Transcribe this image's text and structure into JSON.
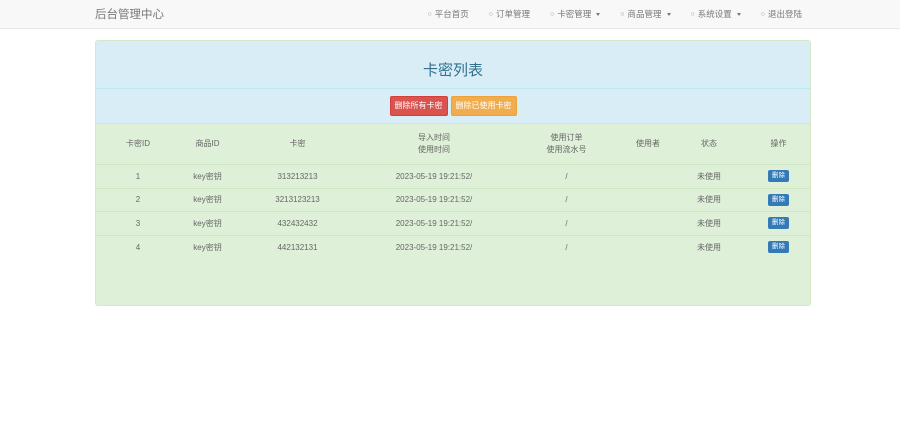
{
  "brand": "后台管理中心",
  "nav": [
    {
      "label": "平台首页",
      "dropdown": false
    },
    {
      "label": "订单管理",
      "dropdown": false
    },
    {
      "label": "卡密管理",
      "dropdown": true
    },
    {
      "label": "商品管理",
      "dropdown": true
    },
    {
      "label": "系统设置",
      "dropdown": true
    },
    {
      "label": "退出登陆",
      "dropdown": false
    }
  ],
  "panel": {
    "title": "卡密列表",
    "delete_all_label": "删除所有卡密",
    "delete_used_label": "删除已使用卡密"
  },
  "table": {
    "headers": {
      "id": "卡密ID",
      "product": "商品ID",
      "key": "卡密",
      "import_time": "导入时间",
      "use_time": "使用时间",
      "order": "使用订单",
      "serial": "使用流水号",
      "user": "使用者",
      "status": "状态",
      "op": "操作"
    },
    "rows": [
      {
        "id": "1",
        "product": "key密钥",
        "key": "313213213",
        "time": "2023-05-19 19:21:52/",
        "order": "/",
        "user": "",
        "status": "未使用",
        "action": "删除"
      },
      {
        "id": "2",
        "product": "key密钥",
        "key": "3213123213",
        "time": "2023-05-19 19:21:52/",
        "order": "/",
        "user": "",
        "status": "未使用",
        "action": "删除"
      },
      {
        "id": "3",
        "product": "key密钥",
        "key": "432432432",
        "time": "2023-05-19 19:21:52/",
        "order": "/",
        "user": "",
        "status": "未使用",
        "action": "删除"
      },
      {
        "id": "4",
        "product": "key密钥",
        "key": "442132131",
        "time": "2023-05-19 19:21:52/",
        "order": "/",
        "user": "",
        "status": "未使用",
        "action": "删除"
      }
    ]
  }
}
